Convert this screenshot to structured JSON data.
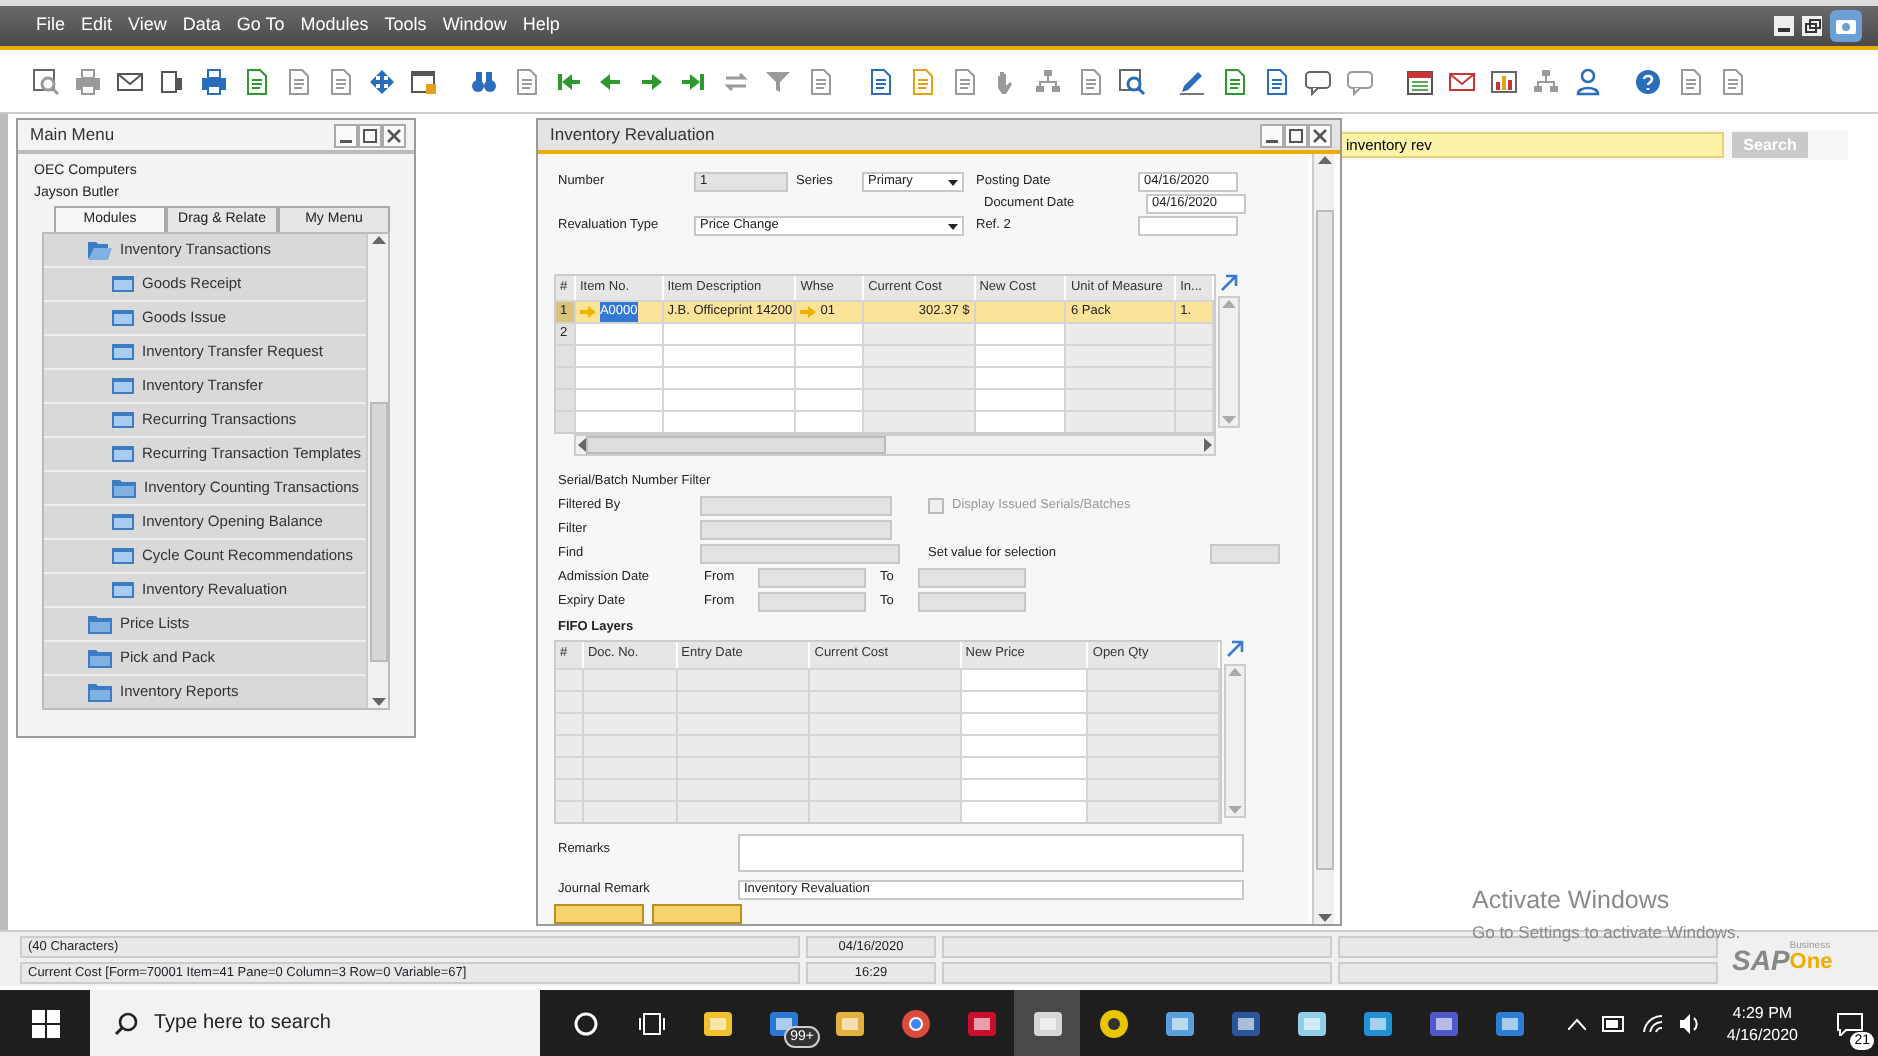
{
  "menu_bar": [
    "File",
    "Edit",
    "View",
    "Data",
    "Go To",
    "Modules",
    "Tools",
    "Window",
    "Help"
  ],
  "main_menu": {
    "title": "Main Menu",
    "company": "OEC Computers",
    "user": "Jayson Butler",
    "tabs": [
      {
        "label": "Modules",
        "selected": true
      },
      {
        "label": "Drag & Relate",
        "selected": false
      },
      {
        "label": "My Menu",
        "selected": false
      }
    ],
    "items": [
      {
        "label": "Inventory Transactions",
        "kind": "folder",
        "expanded": true,
        "children": [
          {
            "label": "Goods Receipt",
            "kind": "form"
          },
          {
            "label": "Goods Issue",
            "kind": "form"
          },
          {
            "label": "Inventory Transfer Request",
            "kind": "form"
          },
          {
            "label": "Inventory Transfer",
            "kind": "form"
          },
          {
            "label": "Recurring Transactions",
            "kind": "form"
          },
          {
            "label": "Recurring Transaction Templates",
            "kind": "form"
          },
          {
            "label": "Inventory Counting Transactions",
            "kind": "folder",
            "expanded": false
          },
          {
            "label": "Inventory Opening Balance",
            "kind": "form"
          },
          {
            "label": "Cycle Count Recommendations",
            "kind": "form"
          },
          {
            "label": "Inventory Revaluation",
            "kind": "form"
          }
        ]
      },
      {
        "label": "Price Lists",
        "kind": "folder",
        "expanded": false
      },
      {
        "label": "Pick and Pack",
        "kind": "folder",
        "expanded": false
      },
      {
        "label": "Inventory Reports",
        "kind": "folder",
        "expanded": false
      }
    ]
  },
  "search": {
    "value": "inventory rev",
    "button": "Search"
  },
  "form": {
    "title": "Inventory Revaluation",
    "number": {
      "label": "Number",
      "value": "1"
    },
    "series": {
      "label": "Series",
      "value": "Primary"
    },
    "posting_date": {
      "label": "Posting Date",
      "value": "04/16/2020"
    },
    "document_date": {
      "label": "Document Date",
      "value": "04/16/2020"
    },
    "revaluation_type": {
      "label": "Revaluation Type",
      "value": "Price Change"
    },
    "ref2": {
      "label": "Ref. 2"
    },
    "items_grid": {
      "columns": [
        "#",
        "Item No.",
        "Item Description",
        "Whse",
        "Current Cost",
        "New Cost",
        "Unit of Measure",
        "In..."
      ],
      "rows": [
        {
          "selected": true,
          "number": "1",
          "item_no": "A0000",
          "description": "J.B. Officeprint 14200",
          "whse": "01",
          "current_cost": "302.37 $",
          "unit_of_measure": "6 Pack",
          "column_8": "1."
        },
        {
          "selected": false,
          "number": "2"
        }
      ]
    },
    "serial_filter": {
      "title": "Serial/Batch Number Filter",
      "filtered_by": "Filtered By",
      "filter": "Filter",
      "find": "Find",
      "display_issued": {
        "label": "Display Issued Serials/Batches",
        "checked": false,
        "disabled": true
      },
      "set_value": "Set value for selection",
      "admission_date": {
        "label": "Admission Date",
        "from": "From",
        "to": "To"
      },
      "expiry_date": {
        "label": "Expiry Date",
        "from": "From",
        "to": "To"
      }
    },
    "fifo": {
      "title": "FIFO Layers",
      "columns": [
        "#",
        "Doc. No.",
        "Entry Date",
        "Current Cost",
        "New Price",
        "Open Qty"
      ]
    },
    "remarks": {
      "label": "Remarks"
    },
    "journal_remark": {
      "label": "Journal Remark",
      "value": "Inventory Revaluation"
    }
  },
  "status_bar": {
    "message": "(40 Characters)",
    "date": "04/16/2020",
    "info": "Current Cost [Form=70001 Item=41 Pane=0 Column=3 Row=0 Variable=67]",
    "time": "16:29"
  },
  "activation": {
    "title": "Activate Windows",
    "hint": "Go to Settings to activate Windows."
  },
  "logo": {
    "name": "SAP",
    "line1": "Business",
    "line2": "One"
  },
  "taskbar": {
    "search_placeholder": "Type here to search",
    "mail_badge": "99+",
    "time": "4:29 PM",
    "date": "4/16/2020",
    "notifications": "21",
    "apps": [
      {
        "selected": false
      },
      {
        "selected": false
      },
      {
        "selected": false
      },
      {
        "selected": false
      },
      {
        "selected": false
      },
      {
        "selected": true
      },
      {
        "selected": false
      },
      {
        "selected": false
      },
      {
        "selected": false
      },
      {
        "selected": false
      },
      {
        "selected": false
      },
      {
        "selected": false
      },
      {
        "selected": false
      }
    ]
  }
}
